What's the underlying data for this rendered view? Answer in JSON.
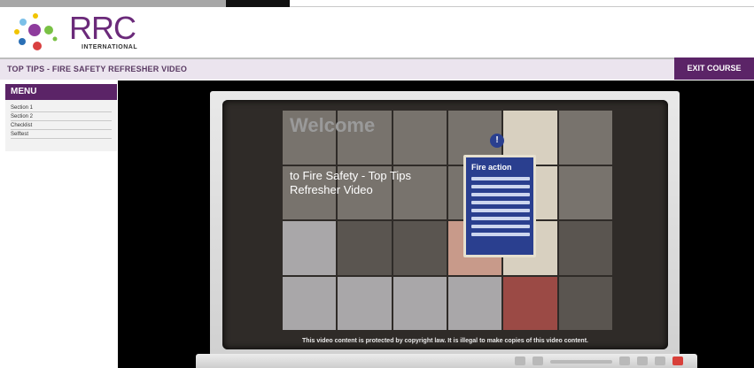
{
  "brand": {
    "logo_text": "RRC",
    "logo_sub": "INTERNATIONAL",
    "colors": {
      "primary": "#5b2467",
      "accent": "#6b2a7a"
    }
  },
  "header": {
    "course_title": "TOP TIPS - FIRE SAFETY REFRESHER VIDEO",
    "exit_label": "EXIT COURSE"
  },
  "menu": {
    "title": "MENU",
    "items": [
      {
        "label": "Section 1"
      },
      {
        "label": "Section 2"
      },
      {
        "label": "Checklist"
      },
      {
        "label": "Selftest"
      }
    ]
  },
  "video": {
    "welcome": "Welcome",
    "subtitle": "to Fire Safety - Top Tips Refresher Video",
    "sign_title": "Fire action",
    "copyright": "This video content is protected by copyright law. It is illegal to make copies of this video content."
  },
  "icons": {
    "logo": "molecule-dots-icon",
    "sign": "info-icon"
  }
}
